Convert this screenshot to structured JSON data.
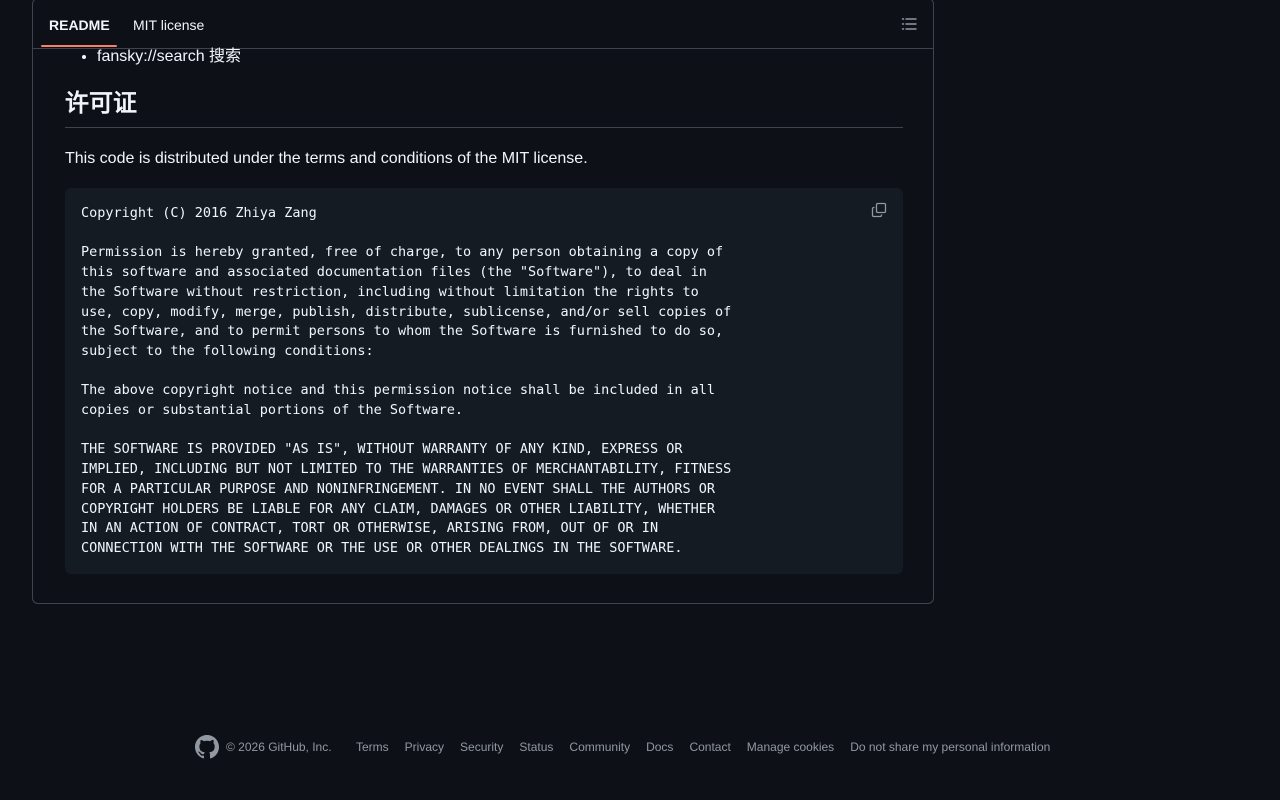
{
  "tabs": [
    {
      "label": "README"
    },
    {
      "label": "MIT license"
    }
  ],
  "readme": {
    "bullet": "fansky://search 搜索",
    "heading": "许可证",
    "paragraph": "This code is distributed under the terms and conditions of the MIT license.",
    "code": "Copyright (C) 2016 Zhiya Zang\n\nPermission is hereby granted, free of charge, to any person obtaining a copy of\nthis software and associated documentation files (the \"Software\"), to deal in\nthe Software without restriction, including without limitation the rights to\nuse, copy, modify, merge, publish, distribute, sublicense, and/or sell copies of\nthe Software, and to permit persons to whom the Software is furnished to do so,\nsubject to the following conditions:\n\nThe above copyright notice and this permission notice shall be included in all\ncopies or substantial portions of the Software.\n\nTHE SOFTWARE IS PROVIDED \"AS IS\", WITHOUT WARRANTY OF ANY KIND, EXPRESS OR\nIMPLIED, INCLUDING BUT NOT LIMITED TO THE WARRANTIES OF MERCHANTABILITY, FITNESS\nFOR A PARTICULAR PURPOSE AND NONINFRINGEMENT. IN NO EVENT SHALL THE AUTHORS OR\nCOPYRIGHT HOLDERS BE LIABLE FOR ANY CLAIM, DAMAGES OR OTHER LIABILITY, WHETHER\nIN AN ACTION OF CONTRACT, TORT OR OTHERWISE, ARISING FROM, OUT OF OR IN\nCONNECTION WITH THE SOFTWARE OR THE USE OR OTHER DEALINGS IN THE SOFTWARE."
  },
  "icons": {
    "outline": "list-unordered-icon",
    "copy": "copy-icon",
    "logo": "github-logo-icon"
  },
  "footer": {
    "copyright": "© 2026 GitHub, Inc.",
    "links": [
      "Terms",
      "Privacy",
      "Security",
      "Status",
      "Community",
      "Docs",
      "Contact",
      "Manage cookies",
      "Do not share my personal information"
    ]
  },
  "colors": {
    "background": "#0d1117",
    "border": "#3d444d",
    "code_background": "#151b23",
    "tab_accent": "#f78166",
    "muted_text": "#9198a1"
  }
}
